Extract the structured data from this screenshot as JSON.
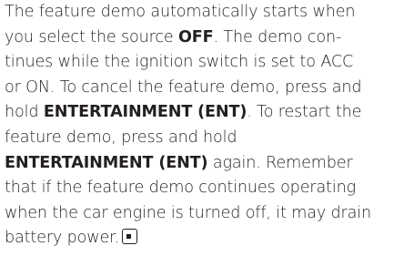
{
  "paragraph": {
    "lines": [
      [
        {
          "text": "The feature demo automatically starts when"
        }
      ],
      [
        {
          "text": "you select the source "
        },
        {
          "text": "OFF",
          "bold": true
        },
        {
          "text": ". The demo con-"
        }
      ],
      [
        {
          "text": "tinues while the ignition switch is set to ACC"
        }
      ],
      [
        {
          "text": "or ON. To cancel the feature demo, press and"
        }
      ],
      [
        {
          "text": "hold "
        },
        {
          "text": "ENTERTAINMENT (ENT)",
          "bold": true
        },
        {
          "text": ". To restart the"
        }
      ],
      [
        {
          "text": "feature demo, press and hold"
        }
      ],
      [
        {
          "text": "ENTERTAINMENT (ENT)",
          "bold": true
        },
        {
          "text": " again. Remember"
        }
      ],
      [
        {
          "text": "that if the feature demo continues operating"
        }
      ],
      [
        {
          "text": "when the car engine is turned off, it may drain"
        }
      ],
      [
        {
          "text": "battery power."
        }
      ]
    ],
    "end_mark_icon": "end-of-section-icon"
  }
}
